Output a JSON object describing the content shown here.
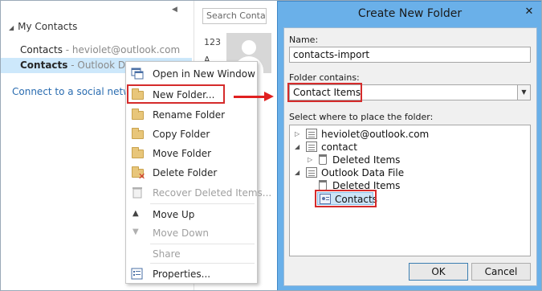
{
  "left_pane": {
    "section_title": "My Contacts",
    "items": [
      {
        "name": "Contacts",
        "sub": " - heviolet@outlook.com"
      },
      {
        "name": "Contacts",
        "sub": " - Outlook Data"
      }
    ],
    "social_link": "Connect to a social network"
  },
  "middle": {
    "search_placeholder": "Search Contacts",
    "index_labels": [
      "123",
      "A"
    ]
  },
  "context_menu": {
    "items": [
      {
        "label": "Open in New Window",
        "icon": "open-window-icon",
        "disabled": false
      },
      {
        "label": "New Folder...",
        "icon": "folder-icon",
        "disabled": false
      },
      {
        "label": "Rename Folder",
        "icon": "folder-icon",
        "disabled": false
      },
      {
        "label": "Copy Folder",
        "icon": "folder-icon",
        "disabled": false
      },
      {
        "label": "Move Folder",
        "icon": "folder-icon",
        "disabled": false
      },
      {
        "label": "Delete Folder",
        "icon": "delete-folder-icon",
        "disabled": false
      },
      {
        "label": "Recover Deleted Items...",
        "icon": "recover-icon",
        "disabled": true
      },
      {
        "label": "Move Up",
        "icon": "triangle-up-icon",
        "disabled": false
      },
      {
        "label": "Move Down",
        "icon": "triangle-down-icon",
        "disabled": true
      },
      {
        "label": "Share",
        "icon": "",
        "disabled": true
      },
      {
        "label": "Properties...",
        "icon": "properties-icon",
        "disabled": false
      }
    ]
  },
  "dialog": {
    "title": "Create New Folder",
    "close": "✕",
    "name_label": "Name:",
    "name_value": "contacts-import",
    "contains_label": "Folder contains:",
    "contains_value": "Contact Items",
    "place_label": "Select where to place the folder:",
    "tree": {
      "account": "heviolet@outlook.com",
      "contact": "contact",
      "deleted1": "Deleted Items",
      "datafile": "Outlook Data File",
      "deleted2": "Deleted Items",
      "contacts": "Contacts"
    },
    "ok": "OK",
    "cancel": "Cancel"
  },
  "colors": {
    "highlight": "#d52b2b",
    "selection": "#cde8fb",
    "dialog_frame": "#6ab0e9"
  }
}
